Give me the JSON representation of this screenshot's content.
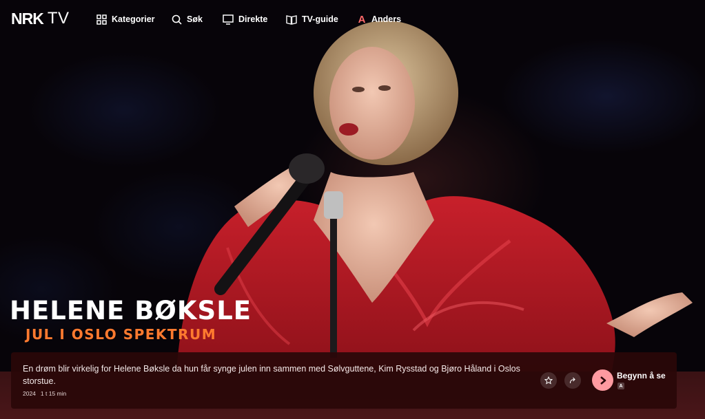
{
  "nav": {
    "logo": {
      "mark": "NRK",
      "tv": "TV"
    },
    "items": [
      {
        "label": "Kategorier",
        "icon": "grid-icon"
      },
      {
        "label": "Søk",
        "icon": "search-icon"
      },
      {
        "label": "Direkte",
        "icon": "tv-screen-icon"
      },
      {
        "label": "TV-guide",
        "icon": "book-icon"
      },
      {
        "label": "Anders",
        "icon": "profile-icon",
        "avatar_letter": "A"
      }
    ]
  },
  "hero": {
    "title": "HELENE BØKSLE",
    "subtitle": "JUL I OSLO SPEKTRUM",
    "description": "En drøm blir virkelig for Helene Bøksle da hun får synge julen inn sammen med Sølvguttene, Kim Rysstad og Bjøro Håland i Oslos storstue.",
    "year": "2024",
    "duration": "1 t 15 min",
    "actions": {
      "favorite_icon": "star-icon",
      "share_icon": "share-icon",
      "play_icon": "play-icon",
      "play_label": "Begynn å se",
      "profile_badge": "A"
    }
  },
  "colors": {
    "subtitle": "#ff7a2f",
    "panel": "#2a0709",
    "play_button": "#ff9aa0",
    "avatar": "#ff6a6a",
    "dress": "#b3141f"
  }
}
